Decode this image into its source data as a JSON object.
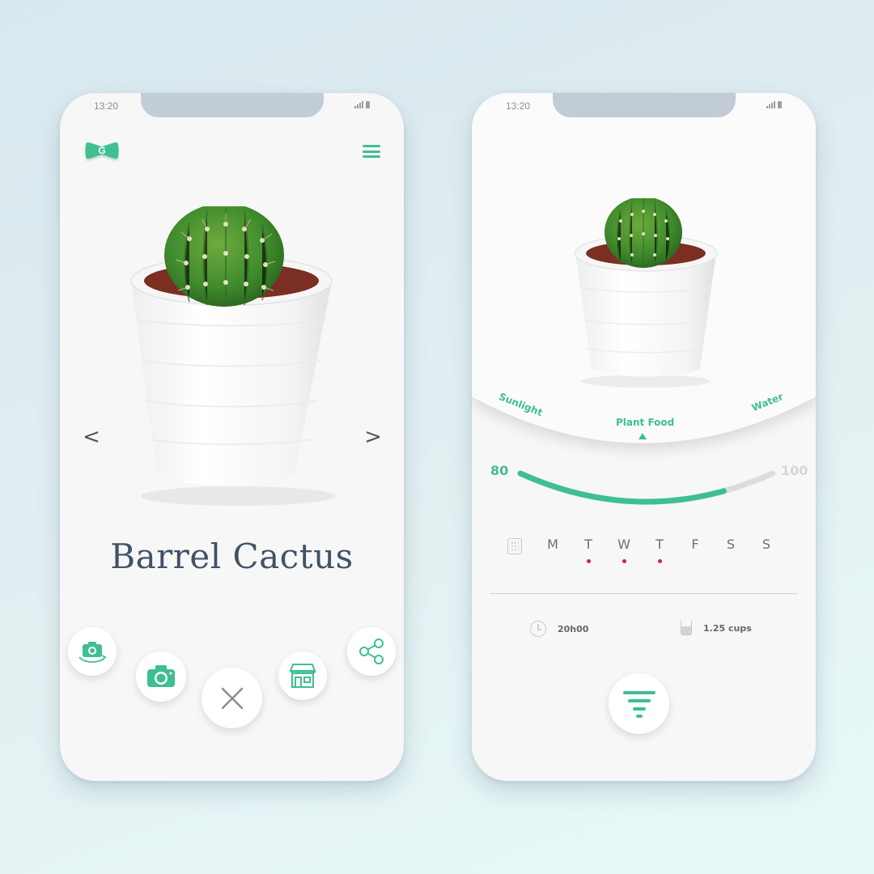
{
  "colors": {
    "accent": "#3fbf90",
    "title": "#415268",
    "marker": "#d2234c",
    "track": "#dcdcdc"
  },
  "left_screen": {
    "status_time": "13:20",
    "logo_letter": "G",
    "icons": {
      "logo": "bow-logo-icon",
      "menu": "hamburger-menu-icon",
      "prev": "chevron-left-icon",
      "next": "chevron-right-icon"
    },
    "nav": {
      "prev": "<",
      "next": ">"
    },
    "plant_name": "Barrel Cactus",
    "actions": [
      {
        "name": "switch-camera-button",
        "icon": "camera-rotate-icon"
      },
      {
        "name": "camera-button",
        "icon": "camera-icon"
      },
      {
        "name": "close-button",
        "icon": "close-icon"
      },
      {
        "name": "store-button",
        "icon": "storefront-icon"
      },
      {
        "name": "share-button",
        "icon": "share-icon"
      }
    ]
  },
  "right_screen": {
    "status_time": "13:20",
    "care_tabs": {
      "sunlight": "Sunlight",
      "plant_food": "Plant Food",
      "water": "Water",
      "selected": "Plant Food"
    },
    "gauge": {
      "min_label": "80",
      "max_label": "100",
      "fill_fraction": 0.8
    },
    "schedule": {
      "icon": "calendar-icon",
      "days": [
        {
          "label": "M",
          "marked": false
        },
        {
          "label": "T",
          "marked": true
        },
        {
          "label": "W",
          "marked": true
        },
        {
          "label": "T",
          "marked": true
        },
        {
          "label": "F",
          "marked": false
        },
        {
          "label": "S",
          "marked": false
        },
        {
          "label": "S",
          "marked": false
        }
      ]
    },
    "time": {
      "icon": "clock-icon",
      "value": "20h00"
    },
    "amount": {
      "icon": "cup-icon",
      "value": "1.25 cups"
    },
    "filter_icon": "filter-icon"
  }
}
